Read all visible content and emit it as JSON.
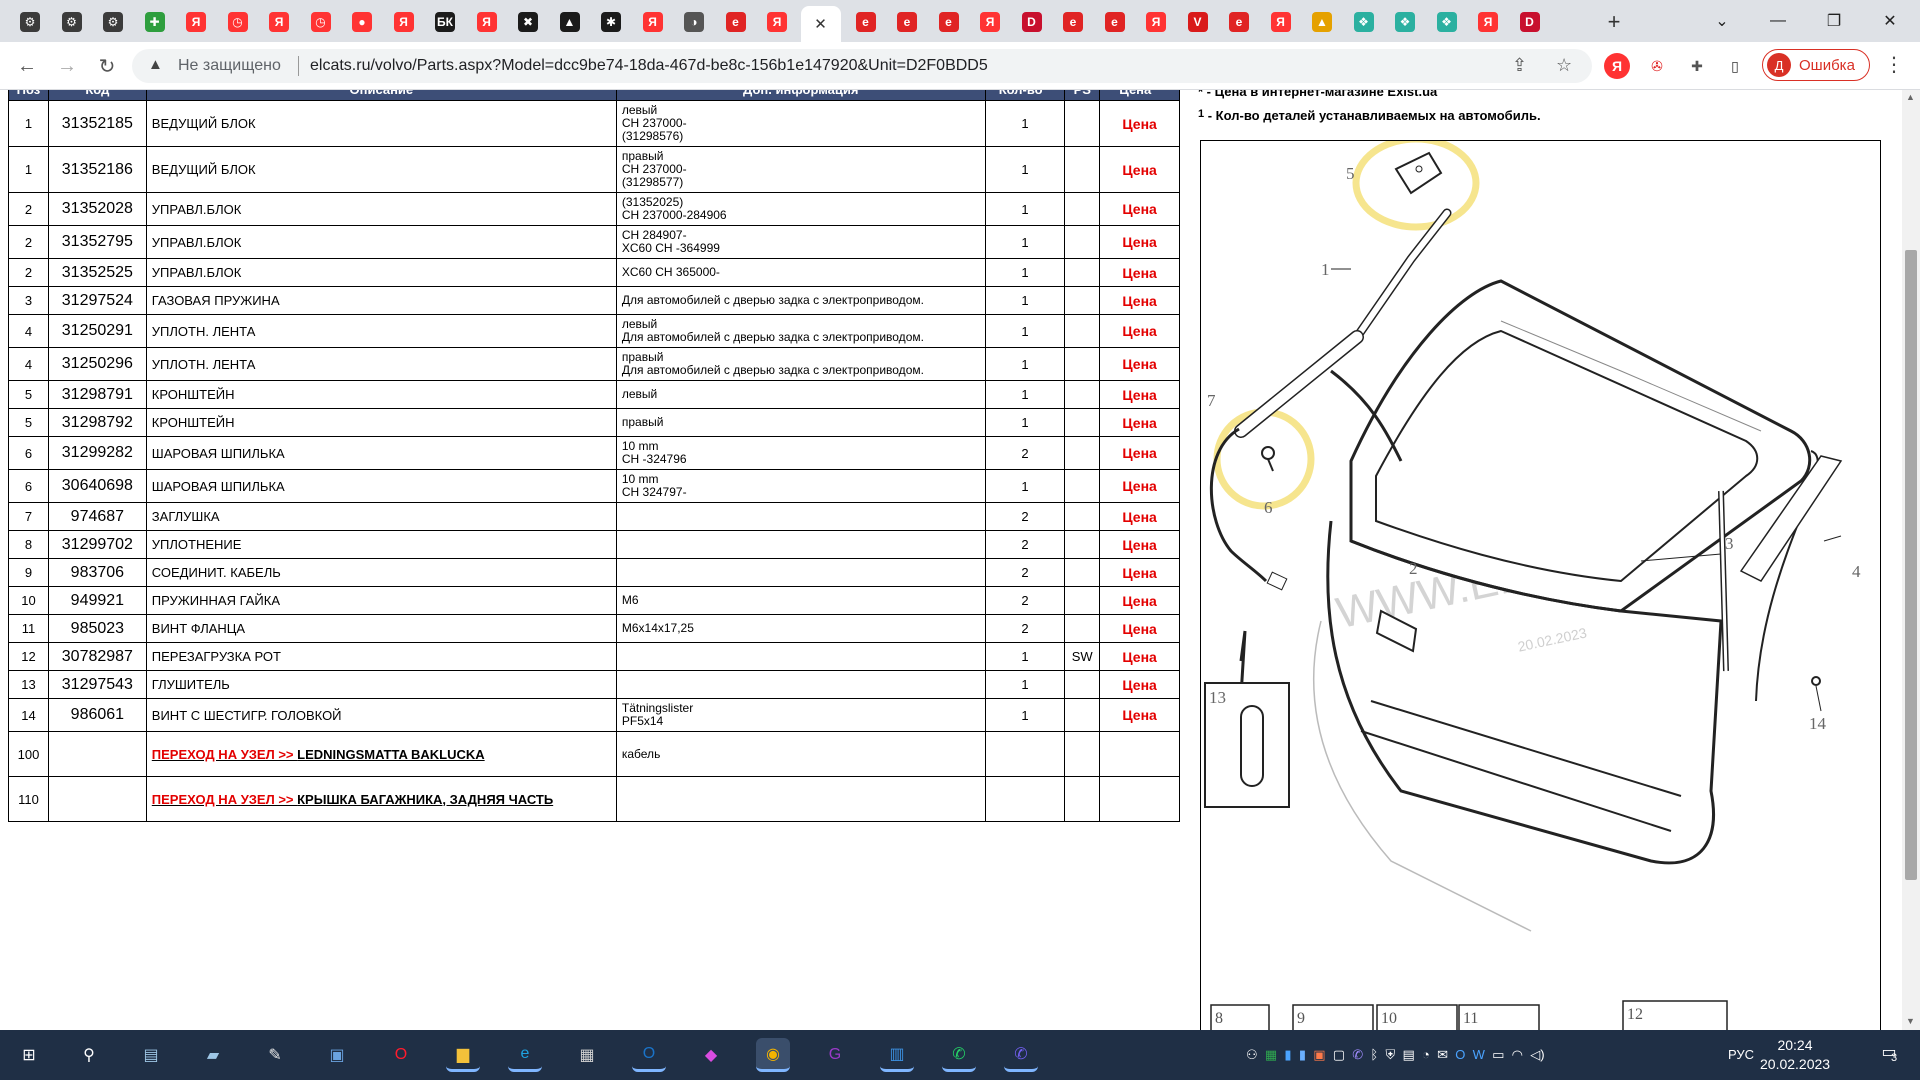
{
  "browser": {
    "tabs": [
      {
        "icon": "chrome-icon",
        "glyph": "⚙",
        "color": "#3b3b3b"
      },
      {
        "icon": "chrome-icon",
        "glyph": "⚙",
        "color": "#3b3b3b"
      },
      {
        "icon": "chrome-icon",
        "glyph": "⚙",
        "color": "#3b3b3b"
      },
      {
        "icon": "puzzle-icon",
        "glyph": "✚",
        "color": "#2e9e3e"
      },
      {
        "icon": "yandex-icon",
        "glyph": "Я",
        "color": "#ff3333"
      },
      {
        "icon": "clock-icon",
        "glyph": "◷",
        "color": "#ff3333"
      },
      {
        "icon": "yandex-icon",
        "glyph": "Я",
        "color": "#ff3333"
      },
      {
        "icon": "clock-icon",
        "glyph": "◷",
        "color": "#ff3333"
      },
      {
        "icon": "map-pin-icon",
        "glyph": "●",
        "color": "#ff3333"
      },
      {
        "icon": "yandex-icon",
        "glyph": "Я",
        "color": "#ff3333"
      },
      {
        "icon": "bk-icon",
        "glyph": "БК",
        "color": "#1b1b1b"
      },
      {
        "icon": "yandex-icon",
        "glyph": "Я",
        "color": "#ff3333"
      },
      {
        "icon": "wrench-icon",
        "glyph": "✖",
        "color": "#1b1b1b"
      },
      {
        "icon": "car-icon",
        "glyph": "▲",
        "color": "#1b1b1b"
      },
      {
        "icon": "gear-icon",
        "glyph": "✱",
        "color": "#1b1b1b"
      },
      {
        "icon": "yandex-icon",
        "glyph": "Я",
        "color": "#ff3333"
      },
      {
        "icon": "globe-icon",
        "glyph": "◑",
        "color": "#555555"
      },
      {
        "icon": "elcats-icon",
        "glyph": "e",
        "color": "#e02424"
      },
      {
        "icon": "yandex-icon",
        "glyph": "Я",
        "color": "#ff3333"
      },
      {
        "icon": "elcats-icon",
        "glyph": "e",
        "color": "#e02424"
      },
      {
        "icon": "elcats-icon",
        "glyph": "e",
        "color": "#e02424"
      },
      {
        "icon": "elcats-icon",
        "glyph": "e",
        "color": "#e02424"
      },
      {
        "icon": "elcats-icon",
        "glyph": "e",
        "color": "#e02424"
      },
      {
        "icon": "yandex-icon",
        "glyph": "Я",
        "color": "#ff3333"
      },
      {
        "icon": "d-icon",
        "glyph": "D",
        "color": "#c8102e"
      },
      {
        "icon": "elcats-icon",
        "glyph": "e",
        "color": "#e02424"
      },
      {
        "icon": "elcats-icon",
        "glyph": "e",
        "color": "#e02424"
      },
      {
        "icon": "yandex-icon",
        "glyph": "Я",
        "color": "#ff3333"
      },
      {
        "icon": "vg-icon",
        "glyph": "V",
        "color": "#d91a1a"
      },
      {
        "icon": "elcats-icon",
        "glyph": "e",
        "color": "#e02424"
      },
      {
        "icon": "yandex-icon",
        "glyph": "Я",
        "color": "#ff3333"
      },
      {
        "icon": "image-icon",
        "glyph": "▲",
        "color": "#e5a100"
      },
      {
        "icon": "apps-icon",
        "glyph": "❖",
        "color": "#2bb0a0"
      },
      {
        "icon": "apps-icon",
        "glyph": "❖",
        "color": "#2bb0a0"
      },
      {
        "icon": "apps-icon",
        "glyph": "❖",
        "color": "#2bb0a0"
      },
      {
        "icon": "yandex-icon",
        "glyph": "Я",
        "color": "#ff3333"
      },
      {
        "icon": "d-icon",
        "glyph": "D",
        "color": "#c8102e"
      }
    ],
    "active_tab_index": 19,
    "address": {
      "security_label": "Не защищено",
      "url": "elcats.ru/volvo/Parts.aspx?Model=dcc9be74-18da-467d-be8c-156b1e147920&Unit=D2F0BDD5"
    },
    "profile_initial": "Д",
    "profile_label": "Ошибка"
  },
  "parts_table": {
    "headers": {
      "pos": "Поз",
      "code": "Код",
      "desc": "Описание",
      "info": "Доп. информация",
      "qty": "Кол-во *",
      "ps": "PS",
      "price": "Цена *"
    },
    "rows": [
      {
        "pos": "1",
        "code": "31352185",
        "desc": "ВЕДУЩИЙ БЛОК",
        "info": [
          "левый",
          "CH 237000-",
          "(31298576)"
        ],
        "qty": "1",
        "ps": "",
        "price": "Цена"
      },
      {
        "pos": "1",
        "code": "31352186",
        "desc": "ВЕДУЩИЙ БЛОК",
        "info": [
          "правый",
          "CH 237000-",
          "(31298577)"
        ],
        "qty": "1",
        "ps": "",
        "price": "Цена"
      },
      {
        "pos": "2",
        "code": "31352028",
        "desc": "УПРАВЛ.БЛОК",
        "info": [
          "(31352025)",
          "CH 237000-284906"
        ],
        "qty": "1",
        "ps": "",
        "price": "Цена"
      },
      {
        "pos": "2",
        "code": "31352795",
        "desc": "УПРАВЛ.БЛОК",
        "info": [
          "CH 284907-",
          "XC60 CH -364999"
        ],
        "qty": "1",
        "ps": "",
        "price": "Цена"
      },
      {
        "pos": "2",
        "code": "31352525",
        "desc": "УПРАВЛ.БЛОК",
        "info": [
          "XC60 CH 365000-"
        ],
        "qty": "1",
        "ps": "",
        "price": "Цена"
      },
      {
        "pos": "3",
        "code": "31297524",
        "desc": "ГАЗОВАЯ ПРУЖИНА",
        "info": [
          "Для автомобилей с дверью задка с электроприводом."
        ],
        "qty": "1",
        "ps": "",
        "price": "Цена"
      },
      {
        "pos": "4",
        "code": "31250291",
        "desc": "УПЛОТН. ЛЕНТА",
        "info": [
          "левый",
          "Для автомобилей с дверью задка с электроприводом."
        ],
        "qty": "1",
        "ps": "",
        "price": "Цена"
      },
      {
        "pos": "4",
        "code": "31250296",
        "desc": "УПЛОТН. ЛЕНТА",
        "info": [
          "правый",
          "Для автомобилей с дверью задка с электроприводом."
        ],
        "qty": "1",
        "ps": "",
        "price": "Цена"
      },
      {
        "pos": "5",
        "code": "31298791",
        "desc": "КРОНШТЕЙН",
        "info": [
          "левый"
        ],
        "qty": "1",
        "ps": "",
        "price": "Цена"
      },
      {
        "pos": "5",
        "code": "31298792",
        "desc": "КРОНШТЕЙН",
        "info": [
          "правый"
        ],
        "qty": "1",
        "ps": "",
        "price": "Цена"
      },
      {
        "pos": "6",
        "code": "31299282",
        "desc": "ШАРОВАЯ ШПИЛЬКА",
        "info": [
          "10 mm",
          "CH -324796"
        ],
        "qty": "2",
        "ps": "",
        "price": "Цена"
      },
      {
        "pos": "6",
        "code": "30640698",
        "desc": "ШАРОВАЯ ШПИЛЬКА",
        "info": [
          "10 mm",
          "CH 324797-"
        ],
        "qty": "1",
        "ps": "",
        "price": "Цена"
      },
      {
        "pos": "7",
        "code": "974687",
        "desc": "ЗАГЛУШКА",
        "info": [],
        "qty": "2",
        "ps": "",
        "price": "Цена"
      },
      {
        "pos": "8",
        "code": "31299702",
        "desc": "УПЛОТНЕНИЕ",
        "info": [],
        "qty": "2",
        "ps": "",
        "price": "Цена"
      },
      {
        "pos": "9",
        "code": "983706",
        "desc": "СОЕДИНИТ. КАБЕЛЬ",
        "info": [],
        "qty": "2",
        "ps": "",
        "price": "Цена"
      },
      {
        "pos": "10",
        "code": "949921",
        "desc": "ПРУЖИННАЯ ГАЙКА",
        "info": [
          "M6"
        ],
        "qty": "2",
        "ps": "",
        "price": "Цена"
      },
      {
        "pos": "11",
        "code": "985023",
        "desc": "ВИНТ ФЛАНЦА",
        "info": [
          "M6x14x17,25"
        ],
        "qty": "2",
        "ps": "",
        "price": "Цена"
      },
      {
        "pos": "12",
        "code": "30782987",
        "desc": "ПЕРЕЗАГРУЗКА РОТ",
        "info": [],
        "qty": "1",
        "ps": "SW",
        "price": "Цена"
      },
      {
        "pos": "13",
        "code": "31297543",
        "desc": "ГЛУШИТЕЛЬ",
        "info": [],
        "qty": "1",
        "ps": "",
        "price": "Цена"
      },
      {
        "pos": "14",
        "code": "986061",
        "desc": "ВИНТ С ШЕСТИГР. ГОЛОВКОЙ",
        "info": [
          "Tätningslister",
          "PF5x14"
        ],
        "qty": "1",
        "ps": "",
        "price": "Цена"
      }
    ],
    "node_rows": [
      {
        "pos": "100",
        "prefix": "ПЕРЕХОД НА УЗЕЛ >>",
        "target": "LEDNINGSMATTA BAKLUCKA",
        "info": "кабель"
      },
      {
        "pos": "110",
        "prefix": "ПЕРЕХОД НА УЗЕЛ >>",
        "target": "КРЫШКА БАГАЖНИКА, ЗАДНЯЯ ЧАСТЬ",
        "info": ""
      }
    ]
  },
  "legend": {
    "price_mark": "*",
    "price_note": " - Цена в интернет-магазине Exist.ua",
    "qty_mark": "1",
    "qty_note": " - Кол-во деталей устанавливаемых на автомобиль."
  },
  "diagram": {
    "callouts": [
      "1",
      "2",
      "3",
      "4",
      "5",
      "6",
      "7",
      "13",
      "14"
    ],
    "thumbs": [
      "8",
      "9",
      "10",
      "11",
      "12"
    ],
    "watermark": "WWW.ELCATS.RU",
    "watermark_year": "20.02.2023",
    "highlight_color": "#f5e07a"
  },
  "taskbar": {
    "apps": [
      {
        "icon": "windows-start-icon",
        "glyph": "⊞",
        "color": "#ffffff"
      },
      {
        "icon": "search-icon",
        "glyph": "⚲",
        "color": "#ffffff"
      },
      {
        "icon": "notepad-icon",
        "glyph": "▤",
        "color": "#9ec7e6"
      },
      {
        "icon": "scanner-icon",
        "glyph": "▰",
        "color": "#9ec7e6"
      },
      {
        "icon": "paint-icon",
        "glyph": "✎",
        "color": "#e8e8e8"
      },
      {
        "icon": "computer-icon",
        "glyph": "▣",
        "color": "#6aa3e0"
      },
      {
        "icon": "opera-icon",
        "glyph": "O",
        "color": "#ff1b2d"
      },
      {
        "icon": "folder-icon",
        "glyph": "▆",
        "color": "#f3c13a"
      },
      {
        "icon": "edge-icon",
        "glyph": "e",
        "color": "#1fa3e0"
      },
      {
        "icon": "calculator-icon",
        "glyph": "▦",
        "color": "#d0d0d0"
      },
      {
        "icon": "outlook-icon",
        "glyph": "O",
        "color": "#1a73c8"
      },
      {
        "icon": "gem-icon",
        "glyph": "◆",
        "color": "#d94ce0"
      },
      {
        "icon": "chrome-icon",
        "glyph": "◉",
        "color": "#f4b400"
      },
      {
        "icon": "pdf-icon",
        "glyph": "G",
        "color": "#9b3ac9"
      },
      {
        "icon": "store-icon",
        "glyph": "▥",
        "color": "#3b8fe0"
      },
      {
        "icon": "whatsapp-icon",
        "glyph": "✆",
        "color": "#25d366"
      },
      {
        "icon": "viber-icon",
        "glyph": "✆",
        "color": "#7360f2"
      }
    ],
    "language": "РУС",
    "time": "20:24",
    "date": "20.02.2023",
    "notifications": "3"
  }
}
